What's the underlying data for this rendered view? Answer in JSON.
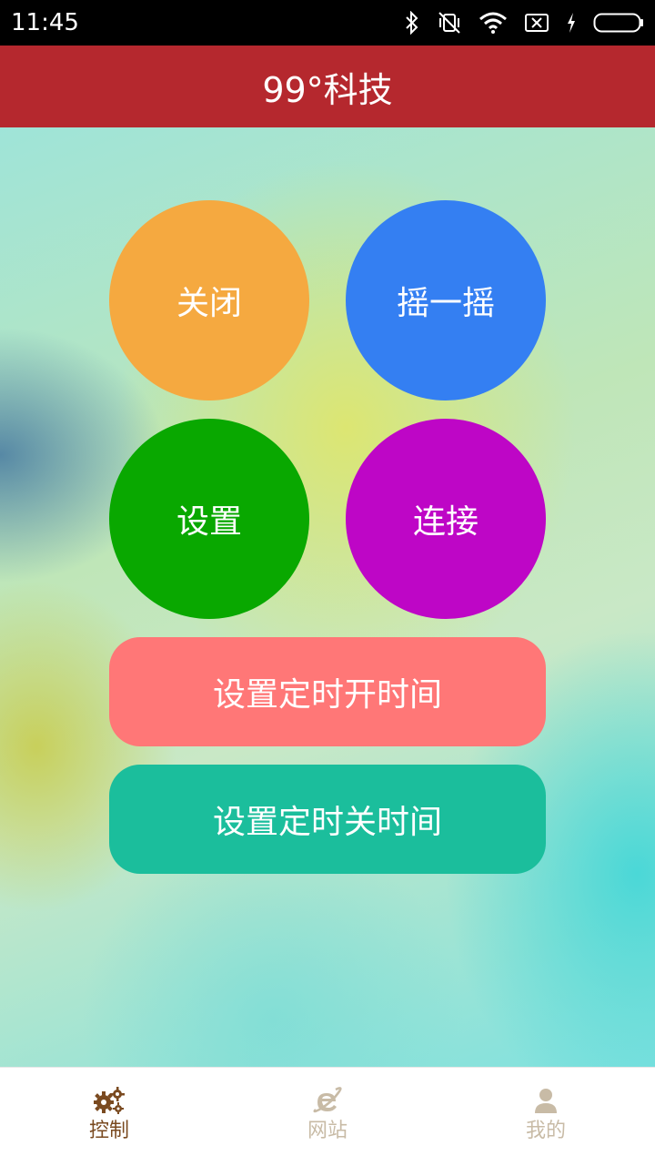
{
  "status_bar": {
    "time": "11:45",
    "icons": [
      "bluetooth-icon",
      "vibrate-off-icon",
      "wifi-icon",
      "no-sim-icon",
      "charging-icon",
      "battery-icon"
    ]
  },
  "app_bar": {
    "title": "99°科技"
  },
  "controls": {
    "close_label": "关闭",
    "shake_label": "摇一摇",
    "settings_label": "设置",
    "connect_label": "连接",
    "timer_on_label": "设置定时开时间",
    "timer_off_label": "设置定时关时间"
  },
  "colors": {
    "app_bar": "#b5282e",
    "close": "#f5a940",
    "shake": "#347ff2",
    "settings": "#09a800",
    "connect": "#be06c6",
    "timer_on": "#ff7777",
    "timer_off": "#1bbe9c",
    "tab_active": "#7a4a20",
    "tab_inactive": "#c8bba6"
  },
  "tab_bar": {
    "tabs": [
      {
        "label": "控制",
        "icon": "gears-icon",
        "active": true
      },
      {
        "label": "网站",
        "icon": "browser-e-icon",
        "active": false
      },
      {
        "label": "我的",
        "icon": "person-icon",
        "active": false
      }
    ]
  }
}
